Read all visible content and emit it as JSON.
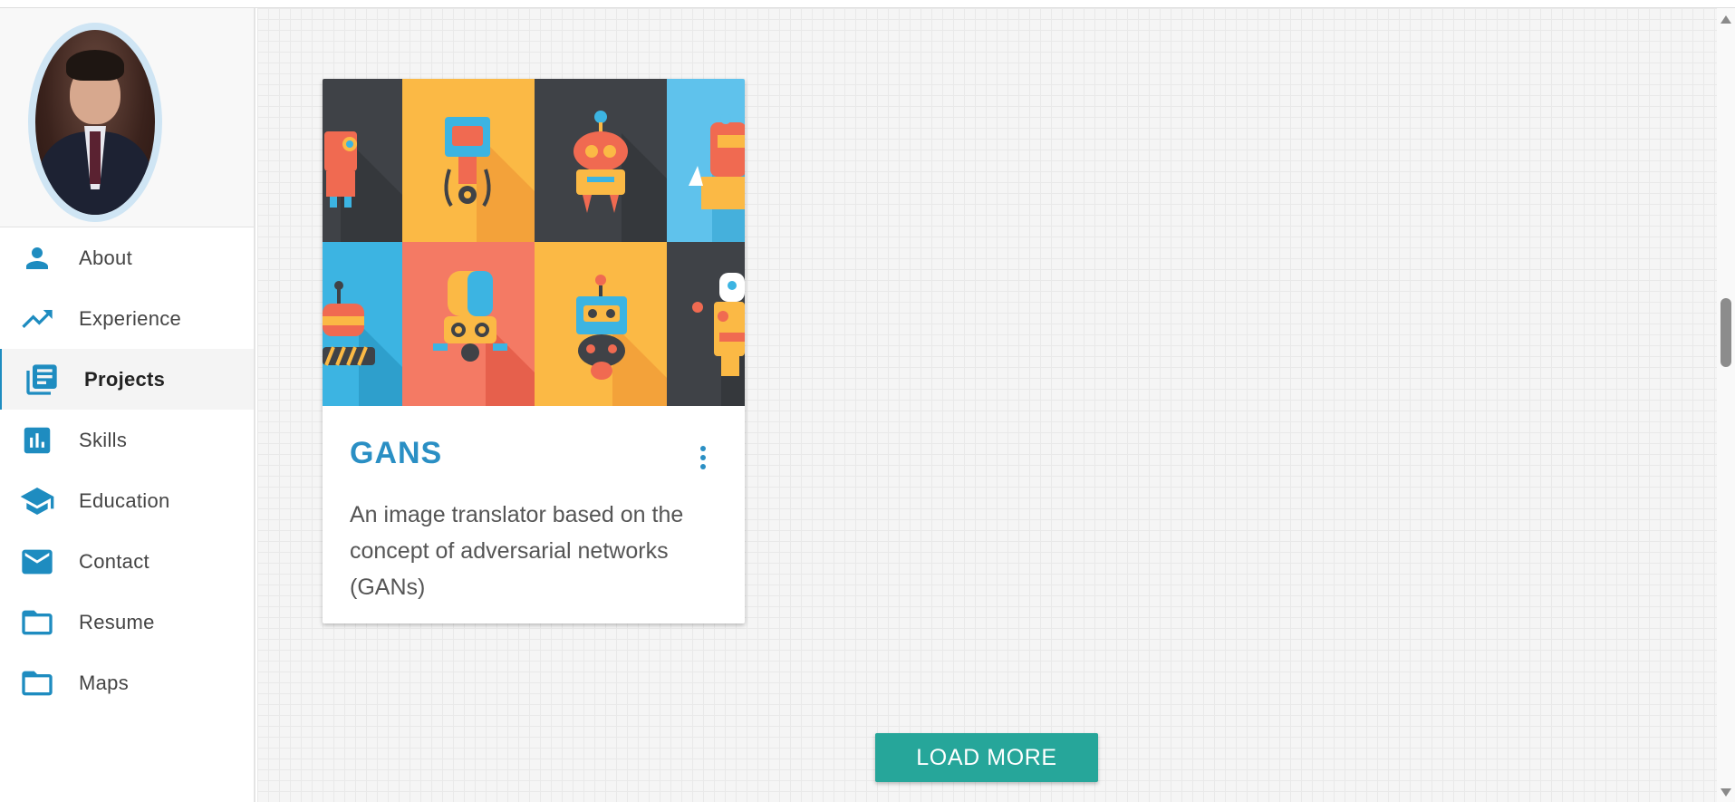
{
  "sidebar": {
    "items": [
      {
        "label": "About",
        "icon": "person-icon"
      },
      {
        "label": "Experience",
        "icon": "trending-up-icon"
      },
      {
        "label": "Projects",
        "icon": "library-books-icon",
        "active": true
      },
      {
        "label": "Skills",
        "icon": "bar-chart-icon"
      },
      {
        "label": "Education",
        "icon": "school-icon"
      },
      {
        "label": "Contact",
        "icon": "mail-icon"
      },
      {
        "label": "Resume",
        "icon": "folder-icon"
      },
      {
        "label": "Maps",
        "icon": "folder-icon"
      }
    ],
    "icon_color": "#1e8cc0"
  },
  "project_card": {
    "title": "GANS",
    "description": "An image translator based on the concept of adversarial networks (GANs)"
  },
  "load_more": {
    "label": "LOAD MORE",
    "color": "#26a69a"
  }
}
